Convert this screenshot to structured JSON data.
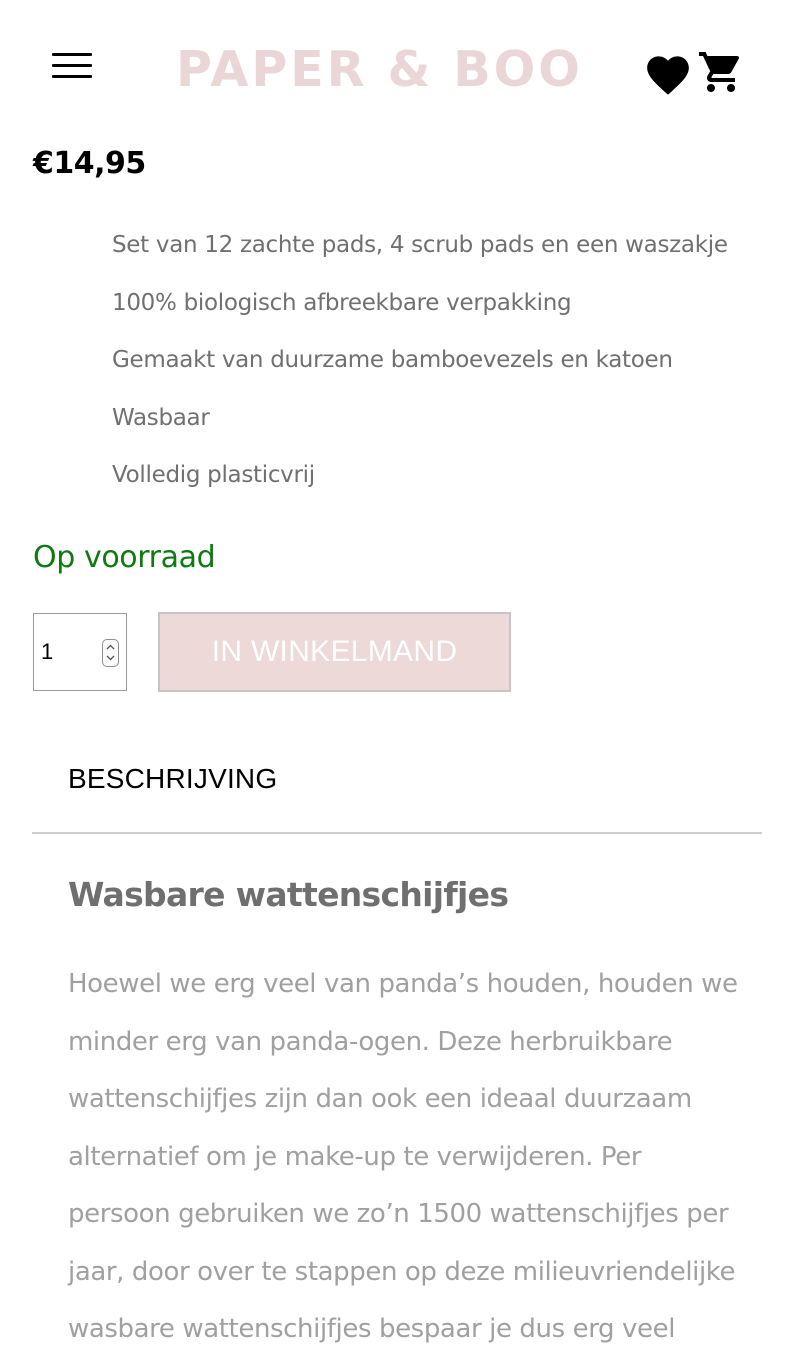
{
  "header": {
    "logo_text": "PAPER & BOO",
    "menu_icon": "hamburger-menu-icon",
    "wishlist_icon": "heart-icon",
    "cart_icon": "cart-icon"
  },
  "product": {
    "price": "€14,95",
    "features": [
      "Set van 12 zachte pads, 4 scrub pads en een waszakje",
      "100% biologisch afbreekbare verpakking",
      "Gemaakt van duurzame bamboevezels en katoen",
      "Wasbaar",
      "Volledig plasticvrij"
    ],
    "stock_status": "Op voorraad",
    "quantity": "1",
    "add_to_cart_label": "IN WINKELMAND"
  },
  "tabs": {
    "description_label": "BESCHRIJVING"
  },
  "description": {
    "title": "Wasbare wattenschijfjes",
    "lines": [
      "Hoewel we erg veel van panda’s houden, houden we",
      "minder erg van panda-ogen. Deze herbruikbare",
      "wattenschijfjes zijn dan ook een ideaal duurzaam",
      "alternatief om je make-up te verwijderen. Per",
      "persoon gebruiken we zo’n 1500 wattenschijfjes per",
      "jaar, door over te stappen op deze milieuvriendelijke",
      "wasbare wattenschijfjes bespaar je dus erg veel"
    ]
  },
  "colors": {
    "logo": "#ead6d6",
    "stock": "#0f7a12",
    "add_button_bg": "#ecd9d8",
    "description_text": "#a0a0a0"
  }
}
